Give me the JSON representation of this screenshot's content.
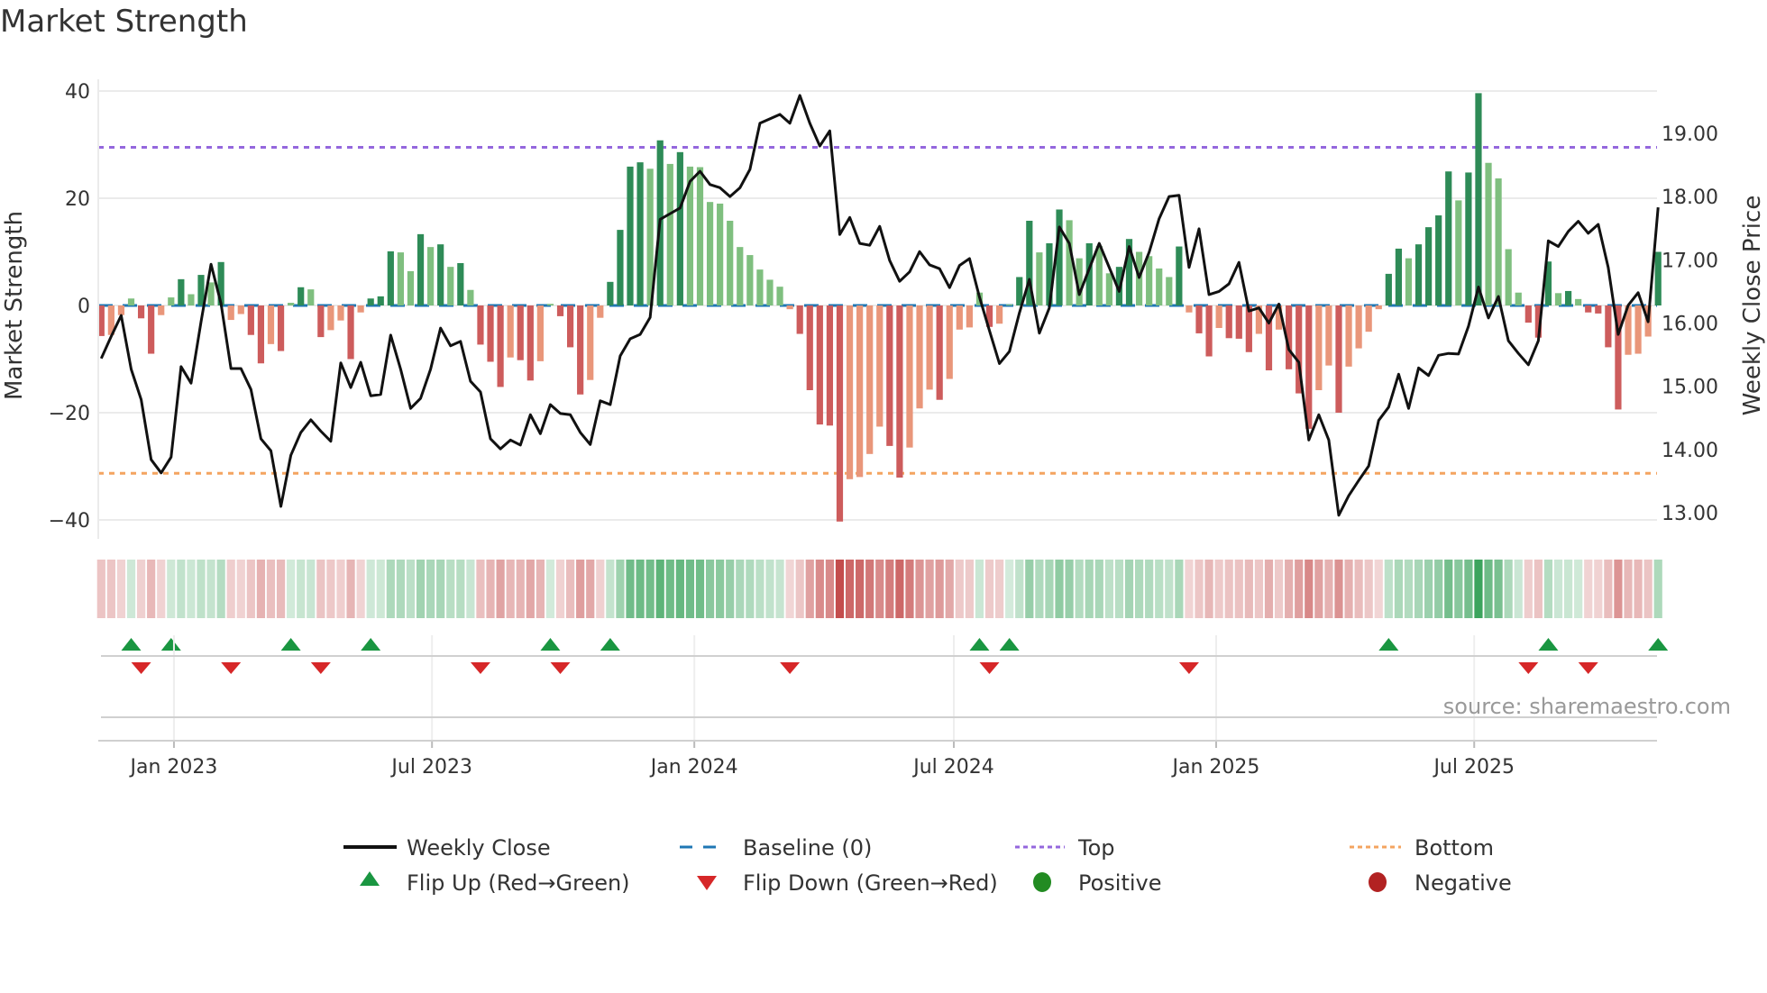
{
  "chart_data": {
    "type": "bar",
    "title": "Market Strength",
    "ylabel": "Market Strength",
    "y2label": "Weekly Close Price",
    "ylim": [
      -42,
      42
    ],
    "y2lim": [
      12.75,
      19.95
    ],
    "yticks": [
      "40",
      "20",
      "0",
      "−20",
      "−40"
    ],
    "ytick_values": [
      40,
      20,
      0,
      -20,
      -40
    ],
    "y2ticks": [
      "19.00",
      "18.00",
      "17.00",
      "16.00",
      "15.00",
      "14.00",
      "13.00"
    ],
    "y2tick_values": [
      19,
      18,
      17,
      16,
      15,
      14,
      13
    ],
    "x_start": "2022-11-11",
    "x_step_days": 7,
    "xticks": [
      {
        "label": "Jan 2023",
        "date": "2023-01-01"
      },
      {
        "label": "Jul 2023",
        "date": "2023-07-01"
      },
      {
        "label": "Jan 2024",
        "date": "2024-01-01"
      },
      {
        "label": "Jul 2024",
        "date": "2024-07-01"
      },
      {
        "label": "Jan 2025",
        "date": "2025-01-01"
      },
      {
        "label": "Jul 2025",
        "date": "2025-07-01"
      }
    ],
    "top_level": 29.5,
    "bottom_level": -31.3,
    "baseline": 0,
    "grid": true,
    "legend_position": "bottom",
    "series": [
      {
        "name": "Market Strength",
        "type": "bar",
        "values": [
          -5.7,
          -5.5,
          -1.8,
          1.3,
          -2.4,
          -9,
          -1.8,
          1.5,
          4.9,
          2.1,
          5.7,
          4.3,
          8.1,
          -2.7,
          -1.6,
          -5.5,
          -10.8,
          -7.2,
          -8.5,
          0.5,
          3.4,
          3,
          -5.9,
          -4.6,
          -2.8,
          -10,
          -1.3,
          1.3,
          1.7,
          10.1,
          9.9,
          6.4,
          13.3,
          10.9,
          11.4,
          7.2,
          7.9,
          2.9,
          -7.3,
          -10.5,
          -15.2,
          -9.7,
          -10.2,
          -14,
          -10.4,
          0.3,
          -2,
          -7.8,
          -16.6,
          -13.9,
          -2.3,
          4.4,
          14.1,
          25.9,
          26.7,
          25.5,
          30.8,
          26.4,
          28.6,
          25.9,
          25.8,
          19.3,
          19,
          15.8,
          10.9,
          9.4,
          6.7,
          4.8,
          3.5,
          -0.7,
          -5.3,
          -15.8,
          -22.2,
          -22.4,
          -40.3,
          -32.4,
          -32,
          -27.7,
          -22.6,
          -26.2,
          -32.1,
          -26.5,
          -19.2,
          -15.7,
          -17.6,
          -13.7,
          -4.5,
          -4.1,
          2.4,
          -4,
          -3.4,
          0.2,
          5.3,
          15.8,
          9.9,
          11.6,
          17.9,
          15.9,
          8.8,
          11.6,
          11.1,
          6,
          7.2,
          12.4,
          10,
          9.2,
          6.9,
          5.3,
          11,
          -1.3,
          -5.2,
          -9.5,
          -4.2,
          -6.1,
          -6.2,
          -8.7,
          -5.3,
          -12.1,
          -4.5,
          -11.9,
          -16.4,
          -23,
          -15.8,
          -11.2,
          -20,
          -11.4,
          -8,
          -4.9,
          -0.7,
          5.9,
          10.6,
          8.8,
          11.4,
          14.6,
          16.8,
          25,
          19.6,
          24.8,
          39.6,
          26.6,
          23.7,
          10.5,
          2.4,
          -3.2,
          -6,
          8.2,
          2.3,
          2.7,
          1.2,
          -1.3,
          -1.5,
          -7.8,
          -19.4,
          -9.2,
          -9,
          -5.8,
          10
        ]
      },
      {
        "name": "Weekly Close",
        "type": "line",
        "axis": "right",
        "values": [
          15.44,
          15.79,
          16.12,
          15.27,
          14.79,
          13.84,
          13.63,
          13.88,
          15.31,
          15.05,
          16.02,
          16.93,
          16.31,
          15.28,
          15.28,
          14.95,
          14.17,
          13.98,
          13.1,
          13.91,
          14.27,
          14.47,
          14.29,
          14.13,
          15.37,
          14.98,
          15.38,
          14.85,
          14.87,
          15.81,
          15.27,
          14.65,
          14.81,
          15.27,
          15.92,
          15.64,
          15.71,
          15.08,
          14.91,
          14.17,
          14.01,
          14.15,
          14.07,
          14.55,
          14.25,
          14.71,
          14.57,
          14.55,
          14.27,
          14.08,
          14.77,
          14.71,
          15.48,
          15.75,
          15.82,
          16.09,
          17.64,
          17.73,
          17.82,
          18.24,
          18.4,
          18.19,
          18.14,
          18.0,
          18.14,
          18.43,
          19.16,
          19.23,
          19.3,
          19.16,
          19.6,
          19.16,
          18.8,
          19.04,
          17.4,
          17.67,
          17.26,
          17.23,
          17.53,
          16.99,
          16.66,
          16.81,
          17.13,
          16.92,
          16.86,
          16.56,
          16.91,
          17.02,
          16.41,
          15.88,
          15.36,
          15.55,
          16.16,
          16.69,
          15.84,
          16.24,
          17.52,
          17.26,
          16.45,
          16.86,
          17.26,
          16.88,
          16.5,
          17.21,
          16.72,
          17.12,
          17.65,
          18.0,
          18.02,
          16.88,
          17.49,
          16.45,
          16.5,
          16.62,
          16.96,
          16.19,
          16.24,
          16.0,
          16.3,
          15.58,
          15.38,
          14.15,
          14.55,
          14.15,
          12.96,
          13.27,
          13.51,
          13.74,
          14.46,
          14.67,
          15.19,
          14.65,
          15.29,
          15.17,
          15.49,
          15.52,
          15.51,
          15.95,
          16.57,
          16.08,
          16.42,
          15.72,
          15.52,
          15.34,
          15.72,
          17.3,
          17.21,
          17.45,
          17.61,
          17.42,
          17.56,
          16.88,
          15.82,
          16.28,
          16.48,
          16.02,
          17.83
        ]
      }
    ],
    "legend": [
      {
        "label": "Weekly Close",
        "symbol": "line"
      },
      {
        "label": "Baseline (0)",
        "symbol": "dash"
      },
      {
        "label": "Top",
        "symbol": "dot"
      },
      {
        "label": "Bottom",
        "symbol": "dot"
      },
      {
        "label": "Flip Up (Red→Green)",
        "symbol": "triangle-up"
      },
      {
        "label": "Flip Down (Green→Red)",
        "symbol": "triangle-down"
      },
      {
        "label": "Positive",
        "symbol": "circle"
      },
      {
        "label": "Negative",
        "symbol": "circle"
      }
    ],
    "source": "source: sharemaestro.com"
  },
  "colors": {
    "pos_strong": "#2e8b57",
    "pos_weak": "#7fbf7f",
    "neg_strong": "#cd5c5c",
    "neg_weak": "#e9967a",
    "line": "#111111",
    "baseline": "#1f77b4",
    "top": "#9467dd",
    "bottom": "#f4a460",
    "flip_up": "#1a9641",
    "flip_down": "#d62728",
    "positive": "#228b22",
    "negative": "#b22222",
    "grid": "#ebebeb"
  }
}
